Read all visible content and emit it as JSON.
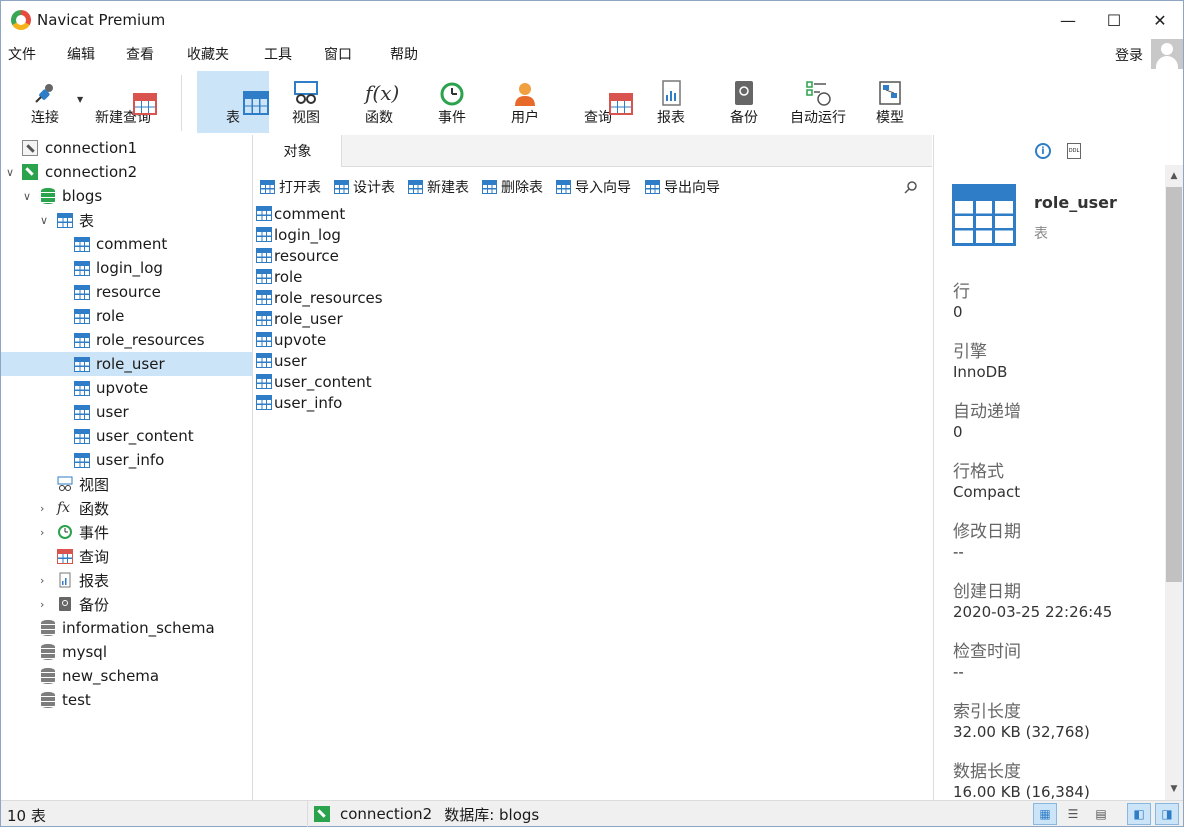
{
  "window": {
    "title": "Navicat Premium",
    "controls": [
      "—",
      "☐",
      "✕"
    ]
  },
  "menu": [
    "文件",
    "编辑",
    "查看",
    "收藏夹",
    "工具",
    "窗口",
    "帮助"
  ],
  "login_label": "登录",
  "toolbar": {
    "connect": "连接",
    "new_query": "新建查询",
    "buttons": [
      "表",
      "视图",
      "函数",
      "事件",
      "用户",
      "查询",
      "报表",
      "备份",
      "自动运行",
      "模型"
    ],
    "active": "表"
  },
  "tree": {
    "connection1": "connection1",
    "connection2": "connection2",
    "blogs": "blogs",
    "tables_folder": "表",
    "tables": [
      "comment",
      "login_log",
      "resource",
      "role",
      "role_resources",
      "role_user",
      "upvote",
      "user",
      "user_content",
      "user_info"
    ],
    "selected_table": "role_user",
    "views": "视图",
    "functions": "函数",
    "events": "事件",
    "queries": "查询",
    "reports": "报表",
    "backups": "备份",
    "databases": [
      "information_schema",
      "mysql",
      "new_schema",
      "test"
    ]
  },
  "objects_tab": "对象",
  "object_toolbar": [
    "打开表",
    "设计表",
    "新建表",
    "删除表",
    "导入向导",
    "导出向导"
  ],
  "object_list": [
    "comment",
    "login_log",
    "resource",
    "role",
    "role_resources",
    "role_user",
    "upvote",
    "user",
    "user_content",
    "user_info"
  ],
  "details": {
    "name": "role_user",
    "type": "表",
    "properties": [
      {
        "label": "行",
        "value": "0"
      },
      {
        "label": "引擎",
        "value": "InnoDB"
      },
      {
        "label": "自动递增",
        "value": "0"
      },
      {
        "label": "行格式",
        "value": "Compact"
      },
      {
        "label": "修改日期",
        "value": "--"
      },
      {
        "label": "创建日期",
        "value": "2020-03-25 22:26:45"
      },
      {
        "label": "检查时间",
        "value": "--"
      },
      {
        "label": "索引长度",
        "value": "32.00 KB (32,768)"
      },
      {
        "label": "数据长度",
        "value": "16.00 KB (16,384)"
      }
    ]
  },
  "status": {
    "count": "10 表",
    "connection": "connection2",
    "database": "数据库: blogs"
  },
  "colors": {
    "accent": "#2f7dc6",
    "selection": "#cce4f7",
    "db_green": "#2ba24c"
  },
  "icons": [
    "app-logo-icon",
    "plug-icon",
    "new-query-icon",
    "table-icon",
    "view-icon",
    "function-icon",
    "event-icon",
    "user-icon",
    "query-icon",
    "report-icon",
    "backup-icon",
    "automation-icon",
    "model-icon",
    "info-icon",
    "ddl-icon",
    "search-icon"
  ]
}
